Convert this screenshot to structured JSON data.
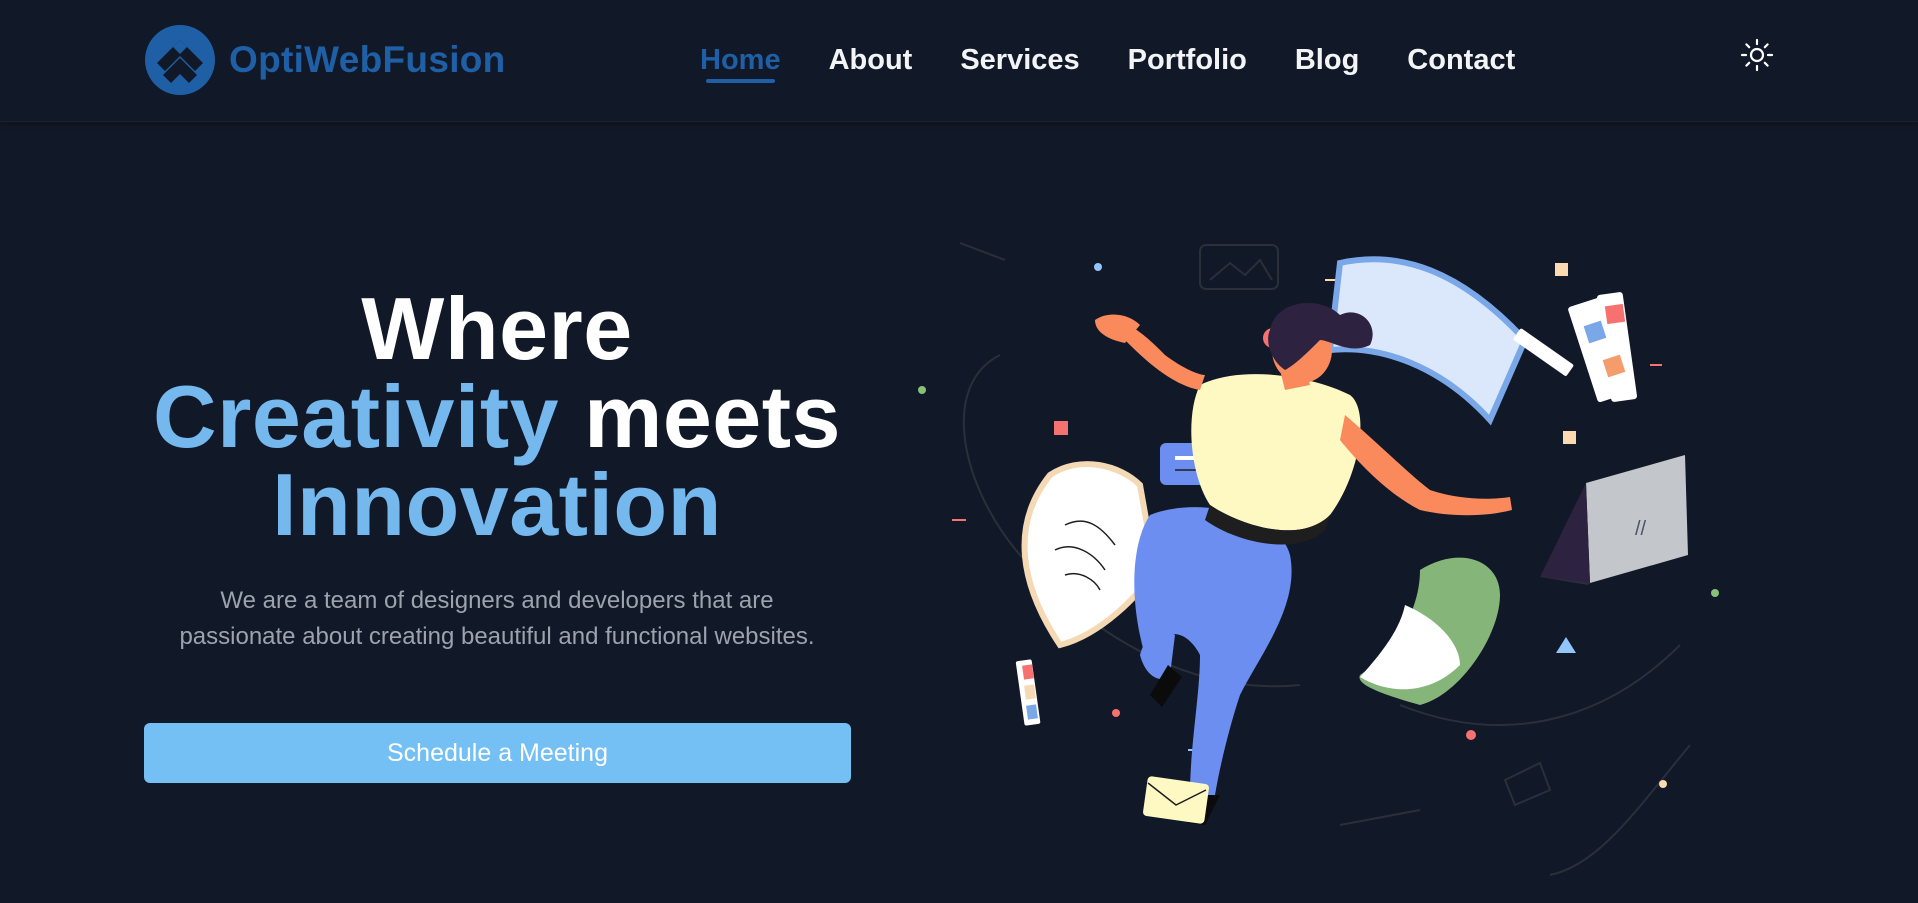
{
  "brand": {
    "name": "OptiWebFusion",
    "logo_color": "#1f5fa6"
  },
  "nav": {
    "items": [
      {
        "label": "Home",
        "active": true
      },
      {
        "label": "About",
        "active": false
      },
      {
        "label": "Services",
        "active": false
      },
      {
        "label": "Portfolio",
        "active": false
      },
      {
        "label": "Blog",
        "active": false
      },
      {
        "label": "Contact",
        "active": false
      }
    ]
  },
  "theme_toggle": {
    "icon": "sun-icon"
  },
  "hero": {
    "headline_line1": "Where",
    "headline_highlight1": "Creativity",
    "headline_meets": " meets",
    "headline_highlight2": "Innovation",
    "subtext": "We are a team of designers and developers that are passionate about creating beautiful and functional websites.",
    "cta_label": "Schedule a Meeting"
  },
  "colors": {
    "background": "#111827",
    "accent": "#74b8ee",
    "button": "#74c0f4",
    "brand": "#1f5fa6",
    "muted_text": "#9ca3af"
  }
}
